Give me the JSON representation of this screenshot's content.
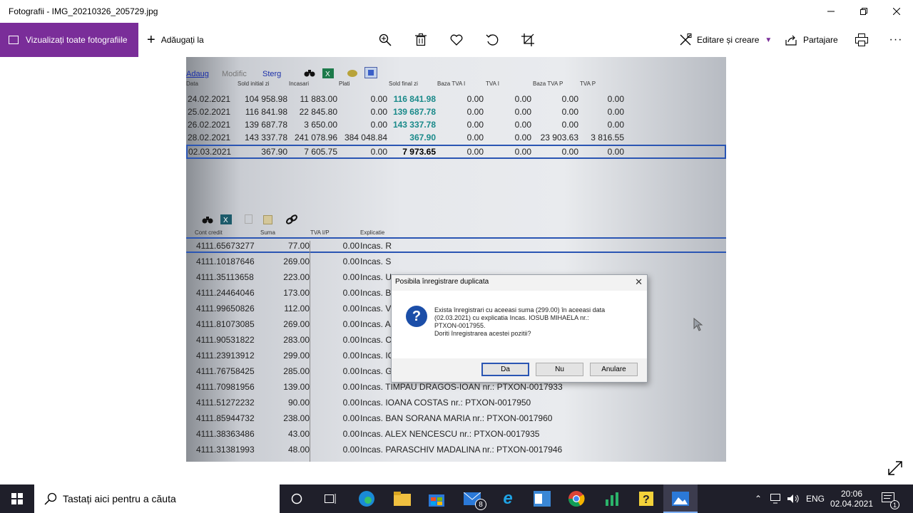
{
  "window": {
    "title": "Fotografii - IMG_20210326_205729.jpg"
  },
  "toolbar": {
    "view_all_label": "Vizualizați toate fotografiile",
    "add_to_label": "Adăugați la",
    "edit_create_label": "Editare și creare",
    "share_label": "Partajare"
  },
  "photo": {
    "toolbar_labels": [
      "Adaug",
      "Modific",
      "Sterg"
    ],
    "grid_headers": [
      "Data",
      "Sold initial zi",
      "Incasari",
      "Plati",
      "Sold final zi",
      "Baza TVA I",
      "TVA I",
      "Baza TVA P",
      "TVA P"
    ],
    "grid_rows": [
      [
        "24.02.2021",
        "104 958.98",
        "11 883.00",
        "0.00",
        "116 841.98",
        "0.00",
        "0.00",
        "0.00",
        "0.00"
      ],
      [
        "25.02.2021",
        "116 841.98",
        "22 845.80",
        "0.00",
        "139 687.78",
        "0.00",
        "0.00",
        "0.00",
        "0.00"
      ],
      [
        "26.02.2021",
        "139 687.78",
        "3 650.00",
        "0.00",
        "143 337.78",
        "0.00",
        "0.00",
        "0.00",
        "0.00"
      ],
      [
        "28.02.2021",
        "143 337.78",
        "241 078.96",
        "384 048.84",
        "367.90",
        "0.00",
        "0.00",
        "23 903.63",
        "3 816.55"
      ],
      [
        "02.03.2021",
        "367.90",
        "7 605.75",
        "0.00",
        "7 973.65",
        "0.00",
        "0.00",
        "0.00",
        "0.00"
      ]
    ],
    "lower_headers": [
      "Cont credit",
      "Suma",
      "TVA I/P",
      "Explicatie"
    ],
    "lower_rows": [
      [
        "4111.65673277",
        "77.00",
        "0.00",
        "Incas. R"
      ],
      [
        "4111.10187646",
        "269.00",
        "0.00",
        "Incas. S"
      ],
      [
        "4111.35113658",
        "223.00",
        "0.00",
        "Incas. U"
      ],
      [
        "4111.24464046",
        "173.00",
        "0.00",
        "Incas. B"
      ],
      [
        "4111.99650826",
        "112.00",
        "0.00",
        "Incas. V"
      ],
      [
        "4111.81073085",
        "269.00",
        "0.00",
        "Incas. A"
      ],
      [
        "4111.90531822",
        "283.00",
        "0.00",
        "Incas. CIOBEA VALENTINA nr.: PTXON-0017970"
      ],
      [
        "4111.23913912",
        "299.00",
        "0.00",
        "Incas. IOSUB MIHAELA nr.: PTXON-0017955"
      ],
      [
        "4111.76758425",
        "285.00",
        "0.00",
        "Incas. GHIRONTE TINCUTA nr.: PTXON-0017938"
      ],
      [
        "4111.70981956",
        "139.00",
        "0.00",
        "Incas. TIMPAU DRAGOS-IOAN nr.: PTXON-0017933"
      ],
      [
        "4111.51272232",
        "90.00",
        "0.00",
        "Incas. IOANA COSTAS nr.: PTXON-0017950"
      ],
      [
        "4111.85944732",
        "238.00",
        "0.00",
        "Incas. BAN SORANA MARIA nr.: PTXON-0017960"
      ],
      [
        "4111.38363486",
        "43.00",
        "0.00",
        "Incas. ALEX NENCESCU nr.: PTXON-0017935"
      ],
      [
        "4111.31381993",
        "48.00",
        "0.00",
        "Incas. PARASCHIV MADALINA nr.: PTXON-0017946"
      ]
    ],
    "dialog": {
      "title": "Posibila înregistrare duplicata",
      "message_line1": "Exista înregistrari cu aceeasi suma (299.00) în aceeasi data",
      "message_line2": "(02.03.2021) cu explicatia Incas. IOSUB MIHAELA nr.:",
      "message_line3": "PTXON-0017955.",
      "message_line4": "Doriti înregistrarea acestei pozitii?",
      "yes_label": "Da",
      "no_label": "Nu",
      "cancel_label": "Anulare"
    }
  },
  "taskbar": {
    "search_placeholder": "Tastați aici pentru a căuta",
    "mail_badge": "8",
    "language": "ENG",
    "time": "20:06",
    "date": "02.04.2021",
    "notification_count": "1"
  }
}
